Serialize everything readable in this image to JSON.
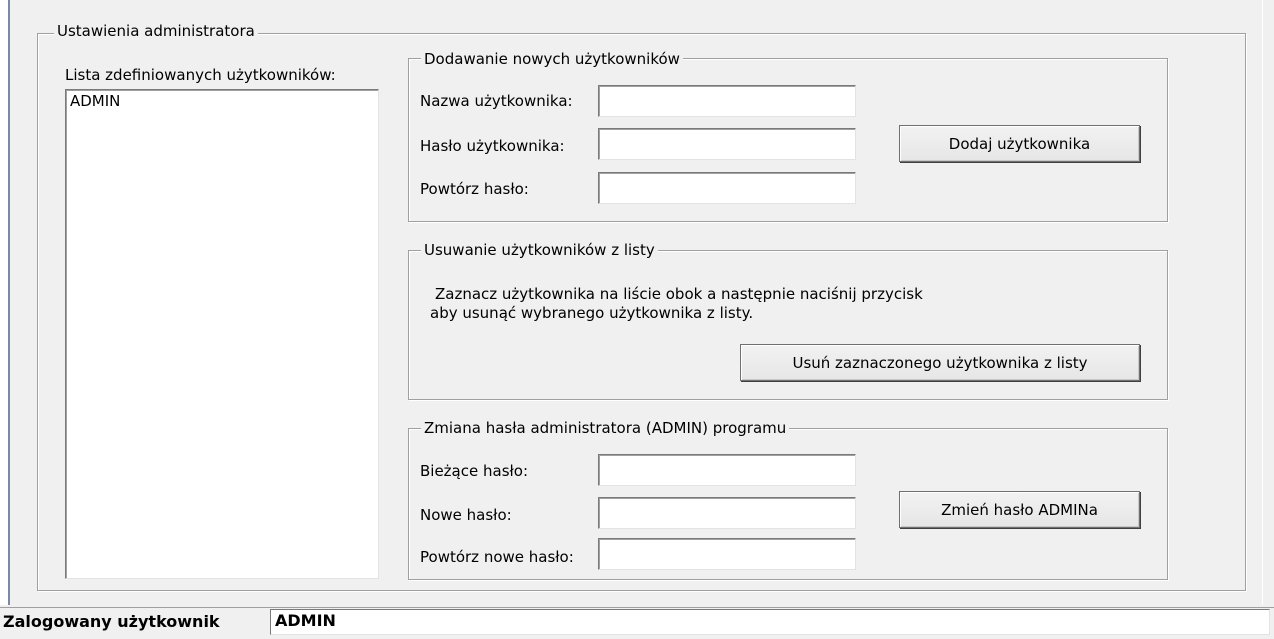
{
  "admin_settings": {
    "title": "Ustawienia administratora",
    "users_list": {
      "label": "Lista zdefiniowanych użytkowników:",
      "items": [
        "ADMIN"
      ]
    },
    "add_user": {
      "title": "Dodawanie nowych użytkowników",
      "username_label": "Nazwa użytkownika:",
      "password_label": "Hasło użytkownika:",
      "repeat_label": "Powtórz hasło:",
      "username_value": "",
      "password_value": "",
      "repeat_value": "",
      "button_label": "Dodaj użytkownika"
    },
    "remove_user": {
      "title": "Usuwanie użytkowników z listy",
      "instruction_line1": "Zaznacz użytkownika na liście obok a następnie naciśnij przycisk",
      "instruction_line2": "aby usunąć wybranego użytkownika z listy.",
      "button_label": "Usuń zaznaczonego użytkownika z listy"
    },
    "change_admin_password": {
      "title": "Zmiana hasła administratora (ADMIN) programu",
      "current_label": "Bieżące hasło:",
      "new_label": "Nowe hasło:",
      "repeat_label": "Powtórz nowe hasło:",
      "current_value": "",
      "new_value": "",
      "repeat_value": "",
      "button_label": "Zmień hasło ADMINa"
    }
  },
  "status_bar": {
    "label": "Zalogowany użytkownik",
    "value": "ADMIN"
  }
}
